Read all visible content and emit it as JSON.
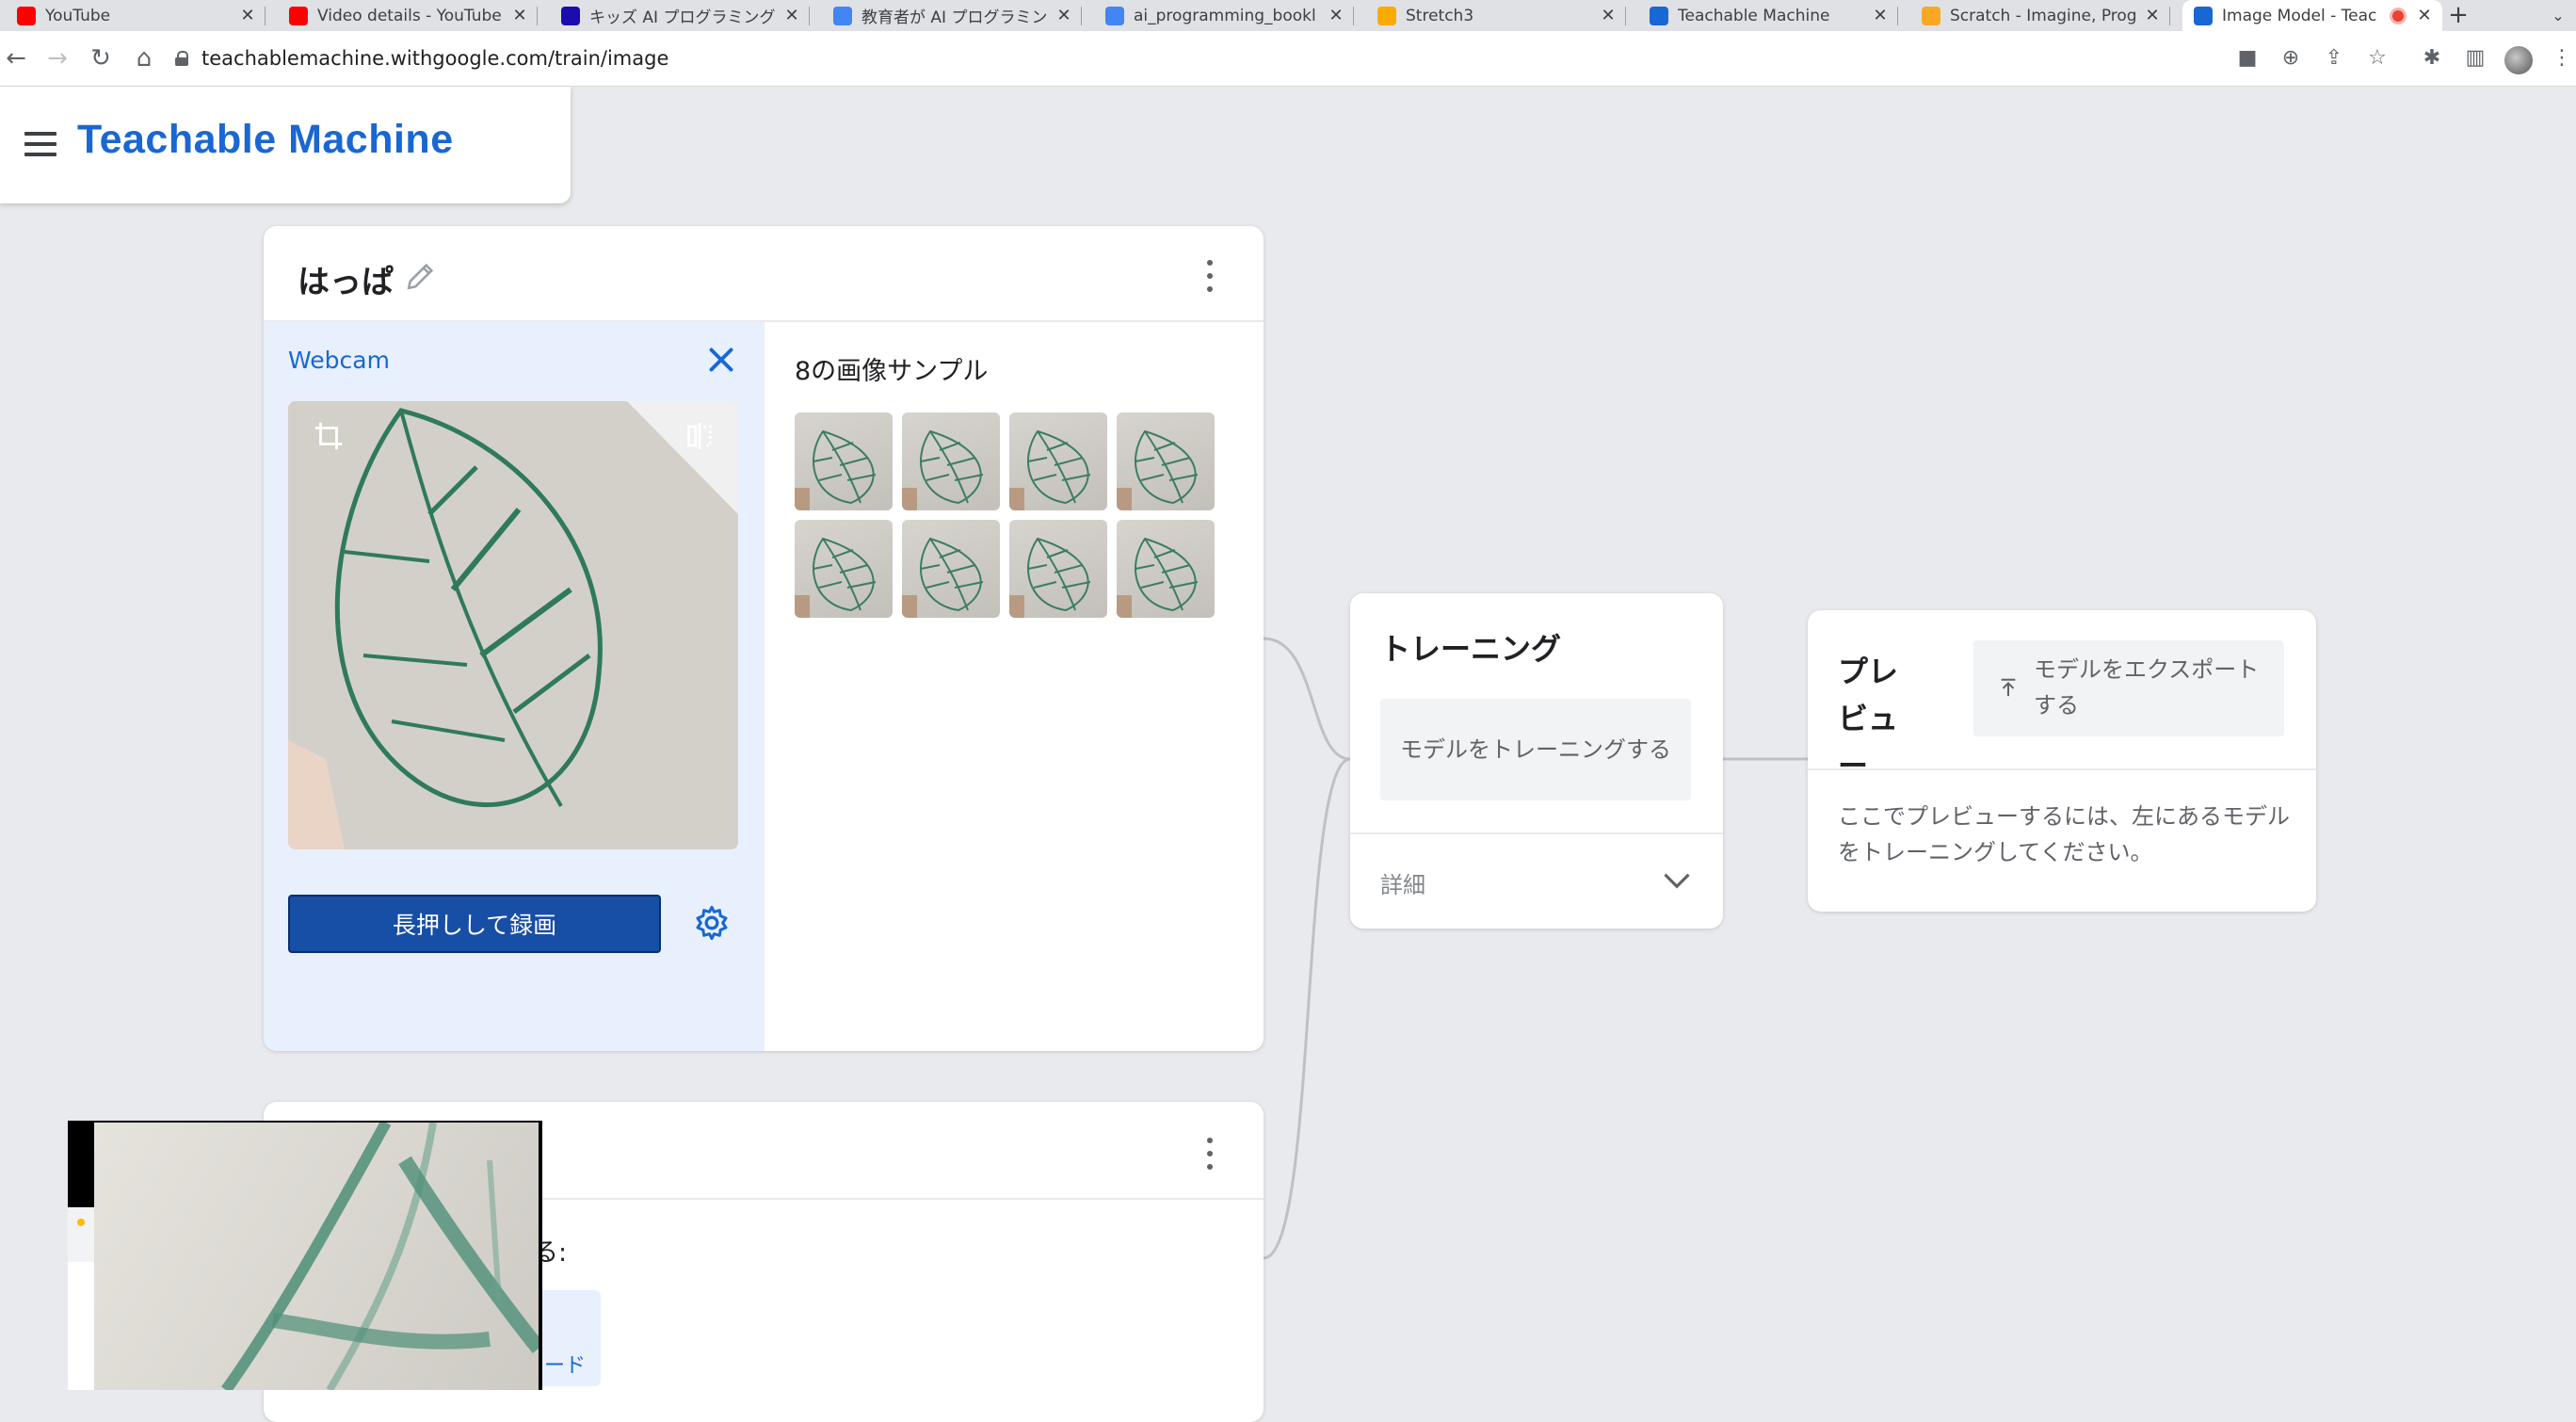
{
  "browser": {
    "tabs": [
      {
        "title": "YouTube",
        "favicon": "youtube-icon",
        "color": "#ff0000"
      },
      {
        "title": "Video details - YouTube",
        "favicon": "youtube-icon",
        "color": "#ff0000"
      },
      {
        "title": "キッズ AI プログラミング",
        "favicon": "doc-icon",
        "color": "#1a0dab"
      },
      {
        "title": "教育者が AI プログラミン",
        "favicon": "google-icon",
        "color": "#4285f4"
      },
      {
        "title": "ai_programming_bookl",
        "favicon": "google-icon",
        "color": "#4285f4"
      },
      {
        "title": "Stretch3",
        "favicon": "stretch-icon",
        "color": "#f9ab00"
      },
      {
        "title": "Teachable Machine",
        "favicon": "tm-icon",
        "color": "#1967d2"
      },
      {
        "title": "Scratch - Imagine, Prog",
        "favicon": "scratch-icon",
        "color": "#f9a825"
      },
      {
        "title": "Image Model - Teac",
        "favicon": "tm-icon",
        "color": "#1967d2"
      }
    ],
    "url": "teachablemachine.withgoogle.com/train/image"
  },
  "app": {
    "brand": "Teachable Machine",
    "accent": "#1967d2"
  },
  "class_card": {
    "name": "はっぱ",
    "webcam_title": "Webcam",
    "record_label": "長押しして録画",
    "samples_title": "8の画像サンプル",
    "sample_count": 8
  },
  "class_card2": {
    "text": "る:",
    "button_label": "ード"
  },
  "training": {
    "title": "トレーニング",
    "train_button": "モデルをトレーニングする",
    "advanced": "詳細"
  },
  "preview": {
    "title": "プレビュー",
    "export_button": "モデルをエクスポートする",
    "message": "ここでプレビューするには、左にあるモデルをトレーニングしてください。"
  }
}
